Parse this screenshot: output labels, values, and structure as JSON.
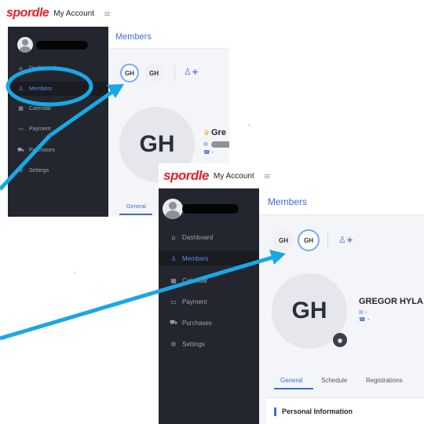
{
  "brand": {
    "logo": "spordle",
    "my_account": "My Account",
    "menu_icon": "hamburger-icon"
  },
  "sidebar": {
    "items": [
      {
        "label": "Dashboard",
        "icon": "home-icon"
      },
      {
        "label": "Members",
        "icon": "user-icon"
      },
      {
        "label": "Calendar",
        "icon": "calendar-icon"
      },
      {
        "label": "Payment",
        "icon": "credit-card-icon"
      },
      {
        "label": "Purchases",
        "icon": "cart-icon"
      },
      {
        "label": "Settings",
        "icon": "gear-icon"
      }
    ]
  },
  "page": {
    "title": "Members"
  },
  "members": {
    "chips": [
      "GH",
      "GH"
    ],
    "add_icon": "add-user-icon",
    "avatar_initials": "GH",
    "name_a": "Gre",
    "name_b": "GREGOR HYLA",
    "email_b": "-",
    "phone_a": "-",
    "phone_b": "-"
  },
  "tabs": [
    "General",
    "Schedule",
    "Registrations"
  ],
  "panel": {
    "title": "Personal Information"
  },
  "colors": {
    "accent": "#3f6bd8",
    "sidebar": "#23262e",
    "annotation": "#19a8e6",
    "logo": "#e4202a"
  }
}
